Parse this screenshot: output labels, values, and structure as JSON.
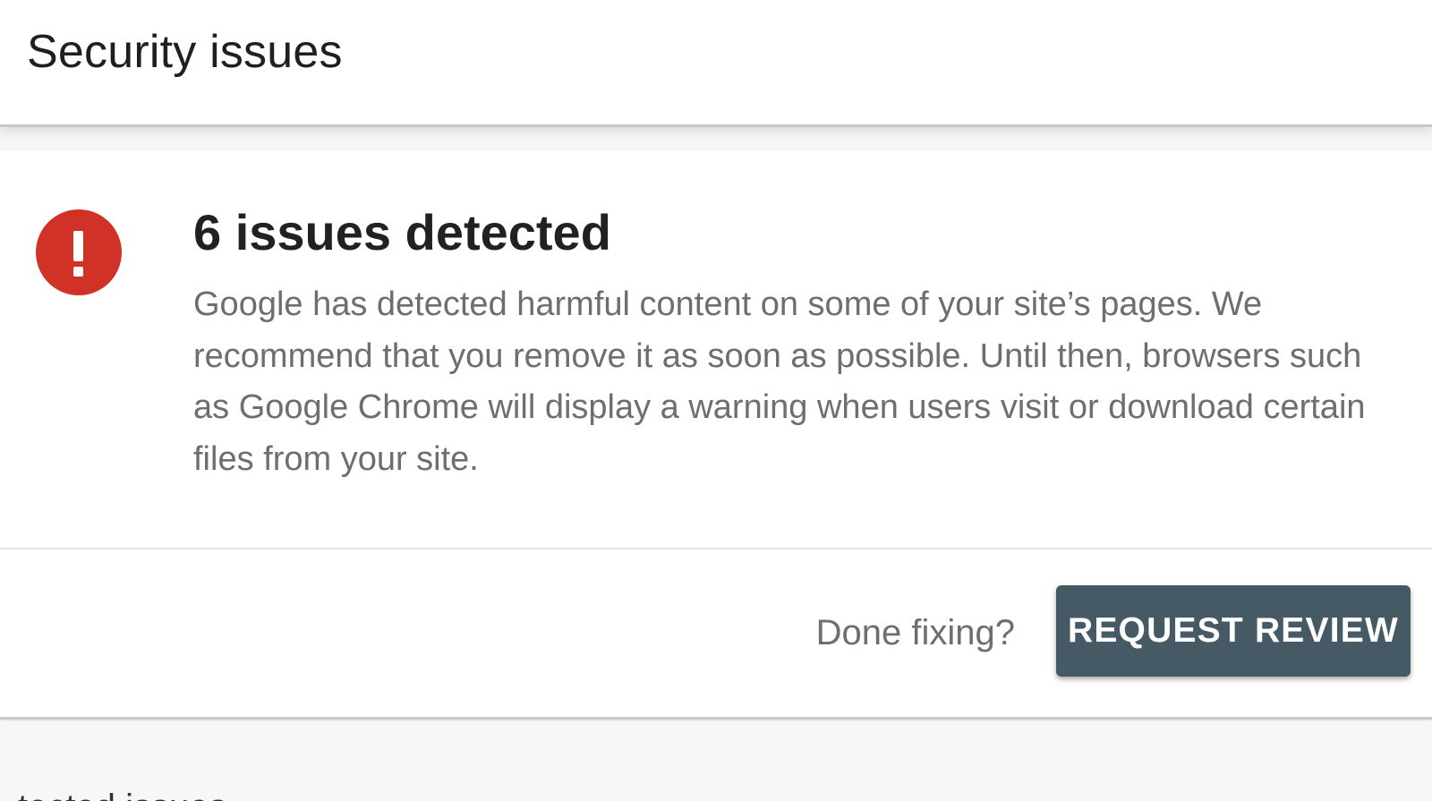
{
  "header": {
    "title": "Security issues"
  },
  "alert_card": {
    "icon": "error-circle-icon",
    "icon_color": "#d03227",
    "title": "6 issues detected",
    "body": "Google has detected harmful content on some of your site’s pages. We recommend that you remove it as soon as possible. Until then, browsers such as Google Chrome will display a warning when users visit or download certain files from your site.",
    "footer": {
      "prompt_text": "Done fixing?",
      "button_label": "REQUEST REVIEW",
      "button_color": "#455a64"
    }
  },
  "next_section": {
    "partial_text": "tected issues"
  }
}
